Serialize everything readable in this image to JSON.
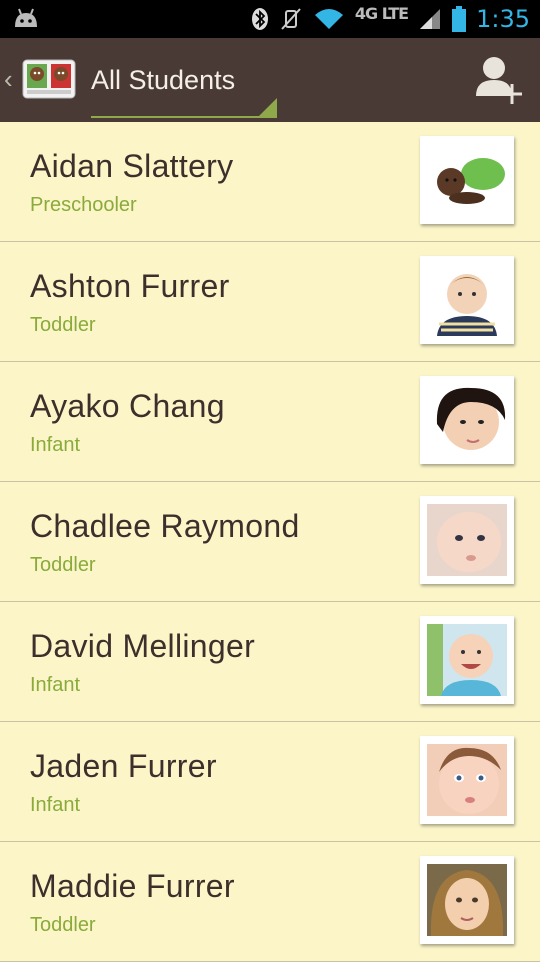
{
  "header": {
    "title": "All Students"
  },
  "status_bar": {
    "time": "1:35",
    "network": "4G LTE"
  },
  "students": [
    {
      "name": "Aidan Slattery",
      "group": "Preschooler"
    },
    {
      "name": "Ashton Furrer",
      "group": "Toddler"
    },
    {
      "name": "Ayako Chang",
      "group": "Infant"
    },
    {
      "name": "Chadlee Raymond",
      "group": "Toddler"
    },
    {
      "name": "David Mellinger",
      "group": "Infant"
    },
    {
      "name": "Jaden Furrer",
      "group": "Infant"
    },
    {
      "name": "Maddie Furrer",
      "group": "Toddler"
    }
  ],
  "colors": {
    "background": "#fbf5c8",
    "action_bar": "#4a3a36",
    "accent_green": "#8aab3c",
    "status_blue": "#33b5e5"
  }
}
